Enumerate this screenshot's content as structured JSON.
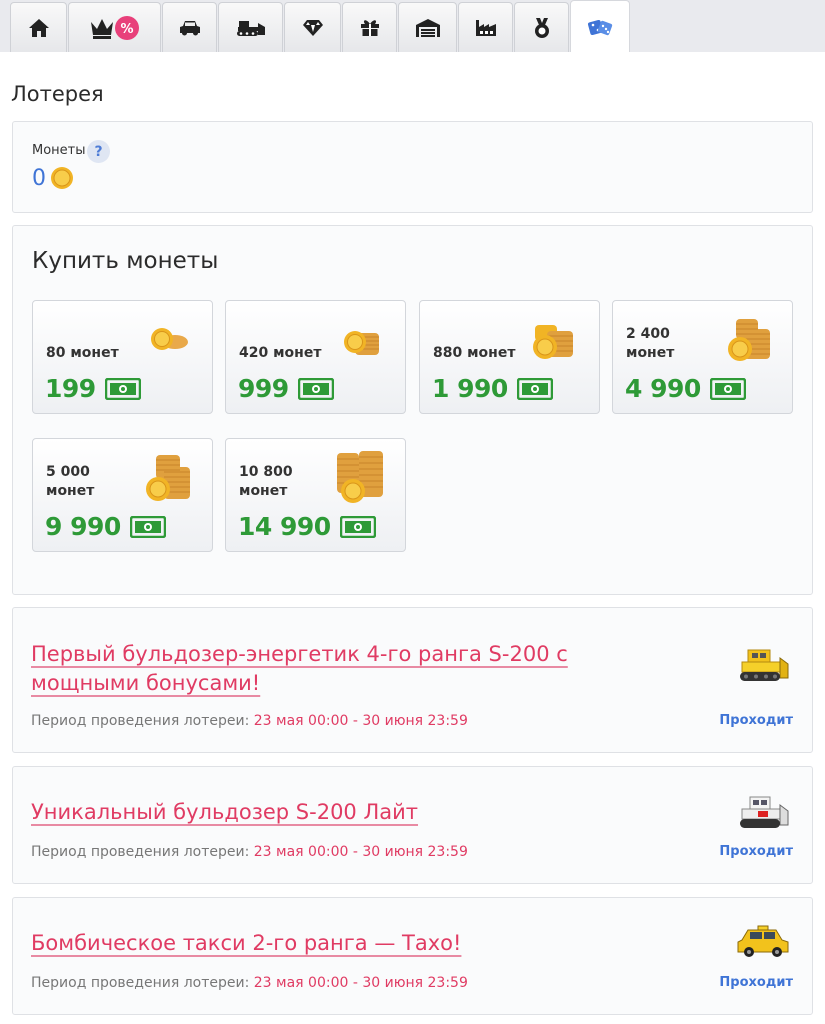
{
  "tabs": [
    {
      "icon": "home-icon"
    },
    {
      "icon": "crown-discount-icon",
      "badge": "%"
    },
    {
      "icon": "car-icon"
    },
    {
      "icon": "bulldozer-icon"
    },
    {
      "icon": "diamond-icon"
    },
    {
      "icon": "gift-icon"
    },
    {
      "icon": "garage-icon"
    },
    {
      "icon": "factory-icon"
    },
    {
      "icon": "medal-icon"
    },
    {
      "icon": "dice-icon",
      "active": true
    }
  ],
  "page": {
    "title": "Лотерея"
  },
  "coins": {
    "label": "Монеты",
    "help": "?",
    "value": "0"
  },
  "buy": {
    "title": "Купить монеты",
    "packages": [
      {
        "amount": "80 монет",
        "price": "199"
      },
      {
        "amount": "420 монет",
        "price": "999"
      },
      {
        "amount": "880 монет",
        "price": "1 990"
      },
      {
        "amount": "2 400 монет",
        "price": "4 990"
      },
      {
        "amount": "5 000 монет",
        "price": "9 990"
      },
      {
        "amount": "10 800 монет",
        "price": "14 990"
      }
    ]
  },
  "lotteries": [
    {
      "title": "Первый бульдозер-энергетик 4-го ранга S-200 с мощными бонусами!",
      "period_label": "Период проведения лотереи:",
      "period": "23 мая 00:00 - 30 июня 23:59",
      "status": "Проходит",
      "image": "yellow-bulldozer"
    },
    {
      "title": "Уникальный бульдозер S-200 Лайт",
      "period_label": "Период проведения лотереи:",
      "period": "23 мая 00:00 - 30 июня 23:59",
      "status": "Проходит",
      "image": "white-bulldozer"
    },
    {
      "title": "Бомбическое такси 2-го ранга — Тахо!",
      "period_label": "Период проведения лотереи:",
      "period": "23 мая 00:00 - 30 июня 23:59",
      "status": "Проходит",
      "image": "yellow-taxi-suv"
    }
  ],
  "colors": {
    "accent_pink": "#e03b63",
    "price_green": "#2e9a37",
    "link_blue": "#3f74d6"
  }
}
